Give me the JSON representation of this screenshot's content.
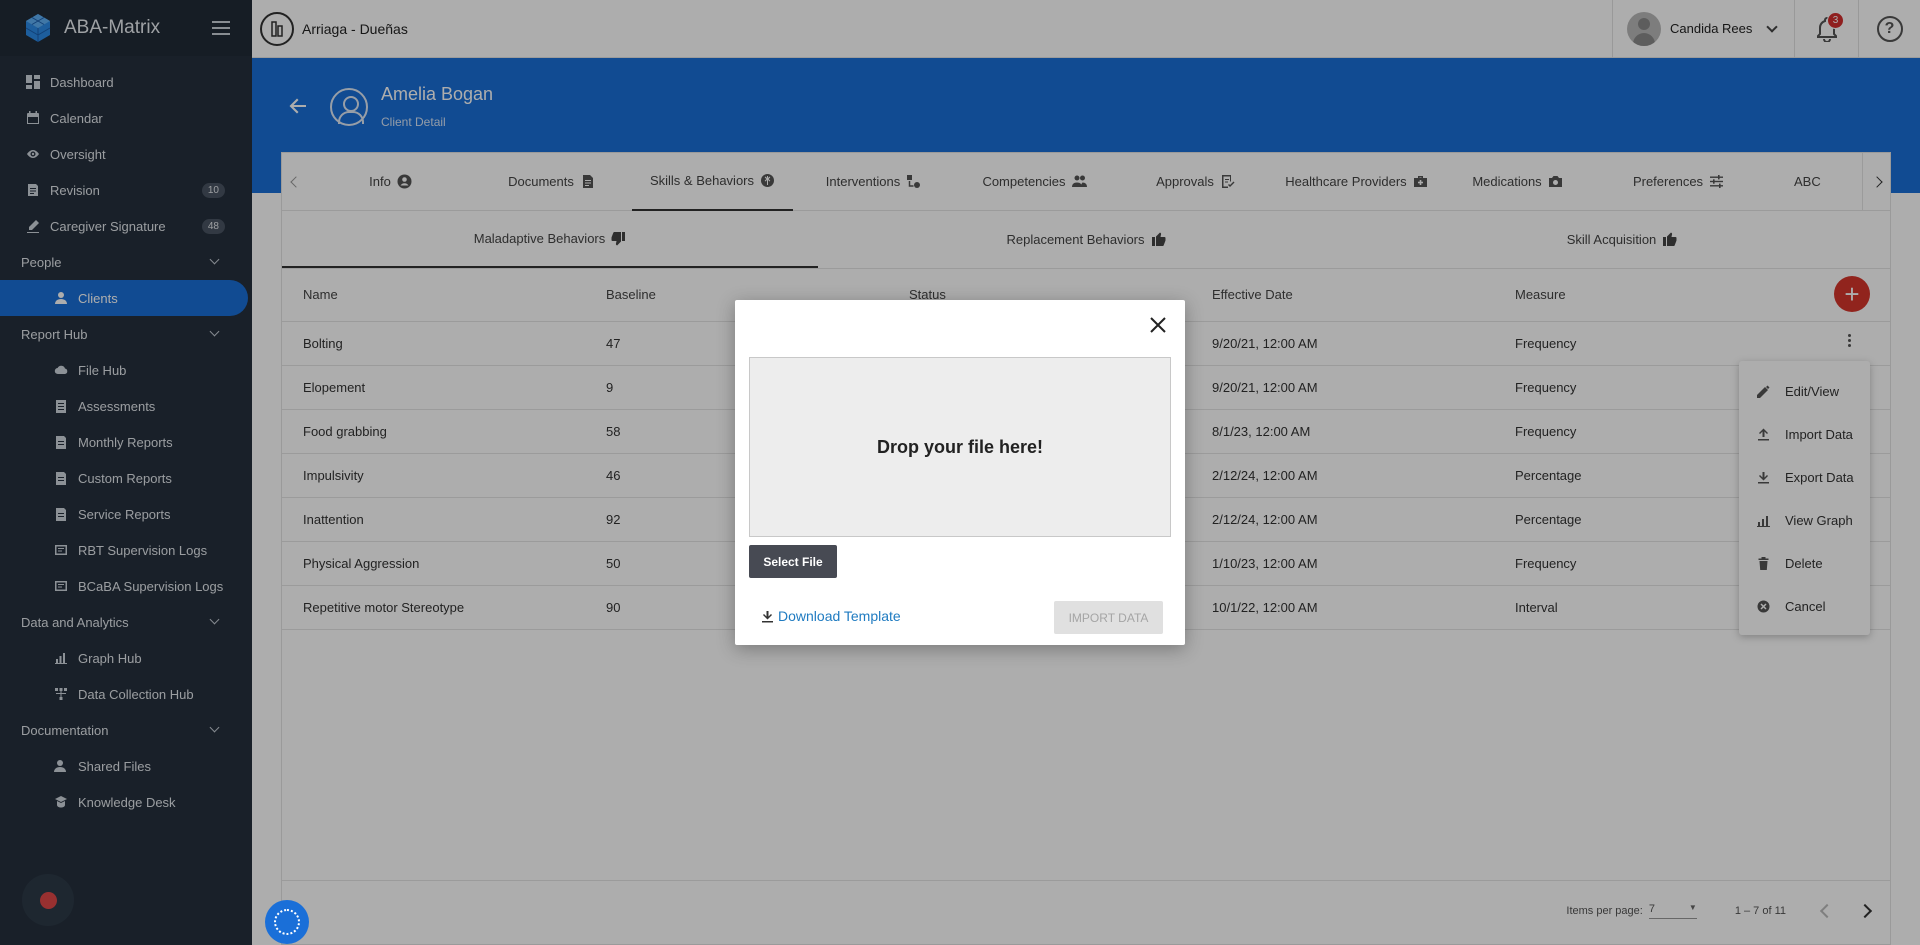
{
  "app": {
    "name": "ABA-Matrix"
  },
  "sidebar": {
    "items": [
      {
        "label": "Dashboard",
        "icon": "dashboard-icon"
      },
      {
        "label": "Calendar",
        "icon": "calendar-icon"
      },
      {
        "label": "Oversight",
        "icon": "eye-icon"
      },
      {
        "label": "Revision",
        "icon": "revision-icon",
        "badge": "10"
      },
      {
        "label": "Caregiver Signature",
        "icon": "signature-icon",
        "badge": "48"
      }
    ],
    "people": {
      "label": "People",
      "items": [
        {
          "label": "Clients",
          "icon": "person-icon",
          "active": true
        }
      ]
    },
    "report_hub": {
      "label": "Report Hub",
      "items": [
        {
          "label": "File Hub",
          "icon": "cloud-icon"
        },
        {
          "label": "Assessments",
          "icon": "assessment-icon"
        },
        {
          "label": "Monthly Reports",
          "icon": "report-icon"
        },
        {
          "label": "Custom Reports",
          "icon": "report-icon"
        },
        {
          "label": "Service Reports",
          "icon": "report-icon"
        },
        {
          "label": "RBT Supervision Logs",
          "icon": "log-icon"
        },
        {
          "label": "BCaBA Supervision Logs",
          "icon": "log-icon"
        }
      ]
    },
    "data_analytics": {
      "label": "Data and Analytics",
      "items": [
        {
          "label": "Graph Hub",
          "icon": "graph-icon"
        },
        {
          "label": "Data Collection Hub",
          "icon": "hub-icon"
        }
      ]
    },
    "documentation": {
      "label": "Documentation",
      "items": [
        {
          "label": "Shared Files",
          "icon": "shared-icon"
        },
        {
          "label": "Knowledge Desk",
          "icon": "knowledge-icon"
        }
      ]
    }
  },
  "topbar": {
    "org_name": "Arriaga - Dueñas",
    "user_name": "Candida Rees",
    "notifications": "3",
    "help": "?"
  },
  "header": {
    "client_name": "Amelia Bogan",
    "subtitle": "Client Detail"
  },
  "tabs": [
    {
      "label": "Info"
    },
    {
      "label": "Documents"
    },
    {
      "label": "Skills & Behaviors",
      "active": true
    },
    {
      "label": "Interventions"
    },
    {
      "label": "Competencies"
    },
    {
      "label": "Approvals"
    },
    {
      "label": "Healthcare Providers"
    },
    {
      "label": "Medications"
    },
    {
      "label": "Preferences"
    },
    {
      "label": "ABC"
    }
  ],
  "subtabs": [
    {
      "label": "Maladaptive Behaviors",
      "active": true
    },
    {
      "label": "Replacement Behaviors"
    },
    {
      "label": "Skill Acquisition"
    }
  ],
  "table": {
    "columns": [
      "Name",
      "Baseline",
      "Status",
      "Effective Date",
      "Measure"
    ],
    "rows": [
      [
        "Bolting",
        "47",
        "",
        "9/20/21, 12:00 AM",
        "Frequency"
      ],
      [
        "Elopement",
        "9",
        "",
        "9/20/21, 12:00 AM",
        "Frequency"
      ],
      [
        "Food grabbing",
        "58",
        "",
        "8/1/23, 12:00 AM",
        "Frequency"
      ],
      [
        "Impulsivity",
        "46",
        "",
        "2/12/24, 12:00 AM",
        "Percentage"
      ],
      [
        "Inattention",
        "92",
        "",
        "2/12/24, 12:00 AM",
        "Percentage"
      ],
      [
        "Physical Aggression",
        "50",
        "",
        "1/10/23, 12:00 AM",
        "Frequency"
      ],
      [
        "Repetitive motor Stereotype",
        "90",
        "",
        "10/1/22, 12:00 AM",
        "Interval"
      ]
    ]
  },
  "add_button": "+",
  "context_menu": [
    "Edit/View",
    "Import Data",
    "Export Data",
    "View Graph",
    "Delete",
    "Cancel"
  ],
  "pager": {
    "items_per_page_label": "Items per page:",
    "items_per_page": "7",
    "range": "1 – 7 of 11"
  },
  "modal": {
    "drop_text": "Drop your file here!",
    "select_file": "Select File",
    "download_template": "Download Template",
    "import_data": "IMPORT DATA"
  },
  "colors": {
    "primary": "#1a6fd8",
    "sidebar": "#25303d",
    "add_button": "#d6352c"
  }
}
